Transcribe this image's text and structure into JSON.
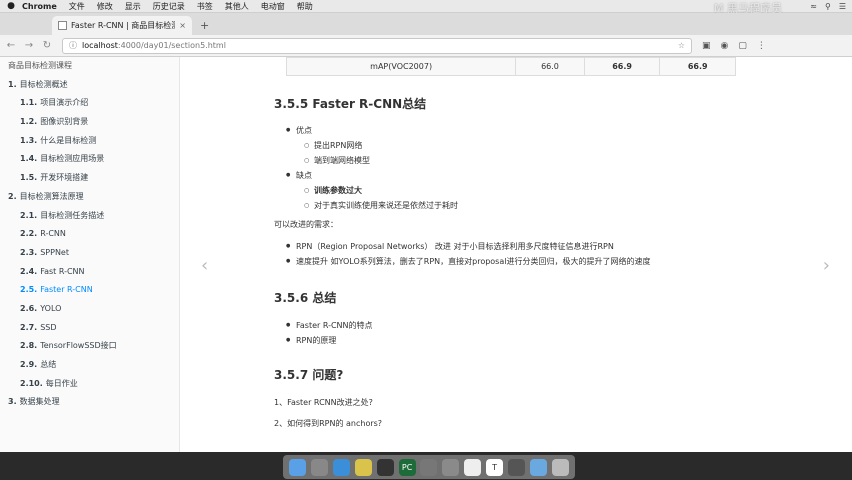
{
  "menubar": {
    "apple": "",
    "items": [
      "Chrome",
      "文件",
      "修改",
      "显示",
      "历史记录",
      "书签",
      "其他人",
      "电动窗",
      "帮助"
    ],
    "watermark": "M 黑马程序员"
  },
  "tab": {
    "title": "Faster R-CNN | 商品目标检测",
    "close": "×"
  },
  "newtab": "+",
  "address": {
    "info": "ⓘ",
    "host": "localhost",
    "path": ":4000/day01/section5.html"
  },
  "sidebar": {
    "top": "商品目标检测课程",
    "items": [
      {
        "num": "1.",
        "label": "目标检测概述",
        "level": 0
      },
      {
        "num": "1.1.",
        "label": "项目演示介绍",
        "level": 1
      },
      {
        "num": "1.2.",
        "label": "图像识别背景",
        "level": 1
      },
      {
        "num": "1.3.",
        "label": "什么是目标检测",
        "level": 1
      },
      {
        "num": "1.4.",
        "label": "目标检测应用场景",
        "level": 1
      },
      {
        "num": "1.5.",
        "label": "开发环境搭建",
        "level": 1
      },
      {
        "num": "2.",
        "label": "目标检测算法原理",
        "level": 0
      },
      {
        "num": "2.1.",
        "label": "目标检测任务描述",
        "level": 1
      },
      {
        "num": "2.2.",
        "label": "R-CNN",
        "level": 1
      },
      {
        "num": "2.3.",
        "label": "SPPNet",
        "level": 1
      },
      {
        "num": "2.4.",
        "label": "Fast R-CNN",
        "level": 1
      },
      {
        "num": "2.5.",
        "label": "Faster R-CNN",
        "level": 1,
        "active": true
      },
      {
        "num": "2.6.",
        "label": "YOLO",
        "level": 1
      },
      {
        "num": "2.7.",
        "label": "SSD",
        "level": 1
      },
      {
        "num": "2.8.",
        "label": "TensorFlowSSD接口",
        "level": 1
      },
      {
        "num": "2.9.",
        "label": "总结",
        "level": 1
      },
      {
        "num": "2.10.",
        "label": "每日作业",
        "level": 1
      },
      {
        "num": "3.",
        "label": "数据集处理",
        "level": 0
      }
    ]
  },
  "table": {
    "label": "mAP(VOC2007)",
    "v1": "66.0",
    "v2": "66.9",
    "v3": "66.9"
  },
  "section1": {
    "title": "3.5.5 Faster R-CNN总结",
    "pros": "优点",
    "pro1": "提出RPN网络",
    "pro2": "端到端网络模型",
    "cons": "缺点",
    "con1": "训练参数过大",
    "con2": "对于真实训练使用来说还是依然过于耗时",
    "improve_label": "可以改进的需求：",
    "imp1": "RPN（Region Proposal Networks） 改进 对于小目标选择利用多尺度特征信息进行RPN",
    "imp2": "速度提升 如YOLO系列算法，删去了RPN，直接对proposal进行分类回归，极大的提升了网络的速度"
  },
  "section2": {
    "title": "3.5.6 总结",
    "i1": "Faster R-CNN的特点",
    "i2": "RPN的原理"
  },
  "section3": {
    "title": "3.5.7 问题?",
    "q1": "1、Faster RCNN改进之处?",
    "q2": "2、如何得到RPN的 anchors?"
  },
  "nav": {
    "prev": "‹",
    "next": "›"
  },
  "dock": [
    {
      "name": "finder",
      "color": "#5aa0e6",
      "glyph": ""
    },
    {
      "name": "launchpad",
      "color": "#888888",
      "glyph": ""
    },
    {
      "name": "safari",
      "color": "#3b8fd8",
      "glyph": ""
    },
    {
      "name": "chrome",
      "color": "#d9c34a",
      "glyph": ""
    },
    {
      "name": "terminal",
      "color": "#333333",
      "glyph": ""
    },
    {
      "name": "pycharm",
      "color": "#1e6b3a",
      "glyph": "PC"
    },
    {
      "name": "preview",
      "color": "#777777",
      "glyph": ""
    },
    {
      "name": "system-preferences",
      "color": "#8a8a8a",
      "glyph": ""
    },
    {
      "name": "textedit",
      "color": "#eeeeee",
      "glyph": ""
    },
    {
      "name": "typora",
      "color": "#ffffff",
      "glyph": "T"
    },
    {
      "name": "quicktime",
      "color": "#555555",
      "glyph": ""
    },
    {
      "name": "downloads",
      "color": "#6aa8e0",
      "glyph": ""
    },
    {
      "name": "trash",
      "color": "#bbbbbb",
      "glyph": ""
    }
  ]
}
